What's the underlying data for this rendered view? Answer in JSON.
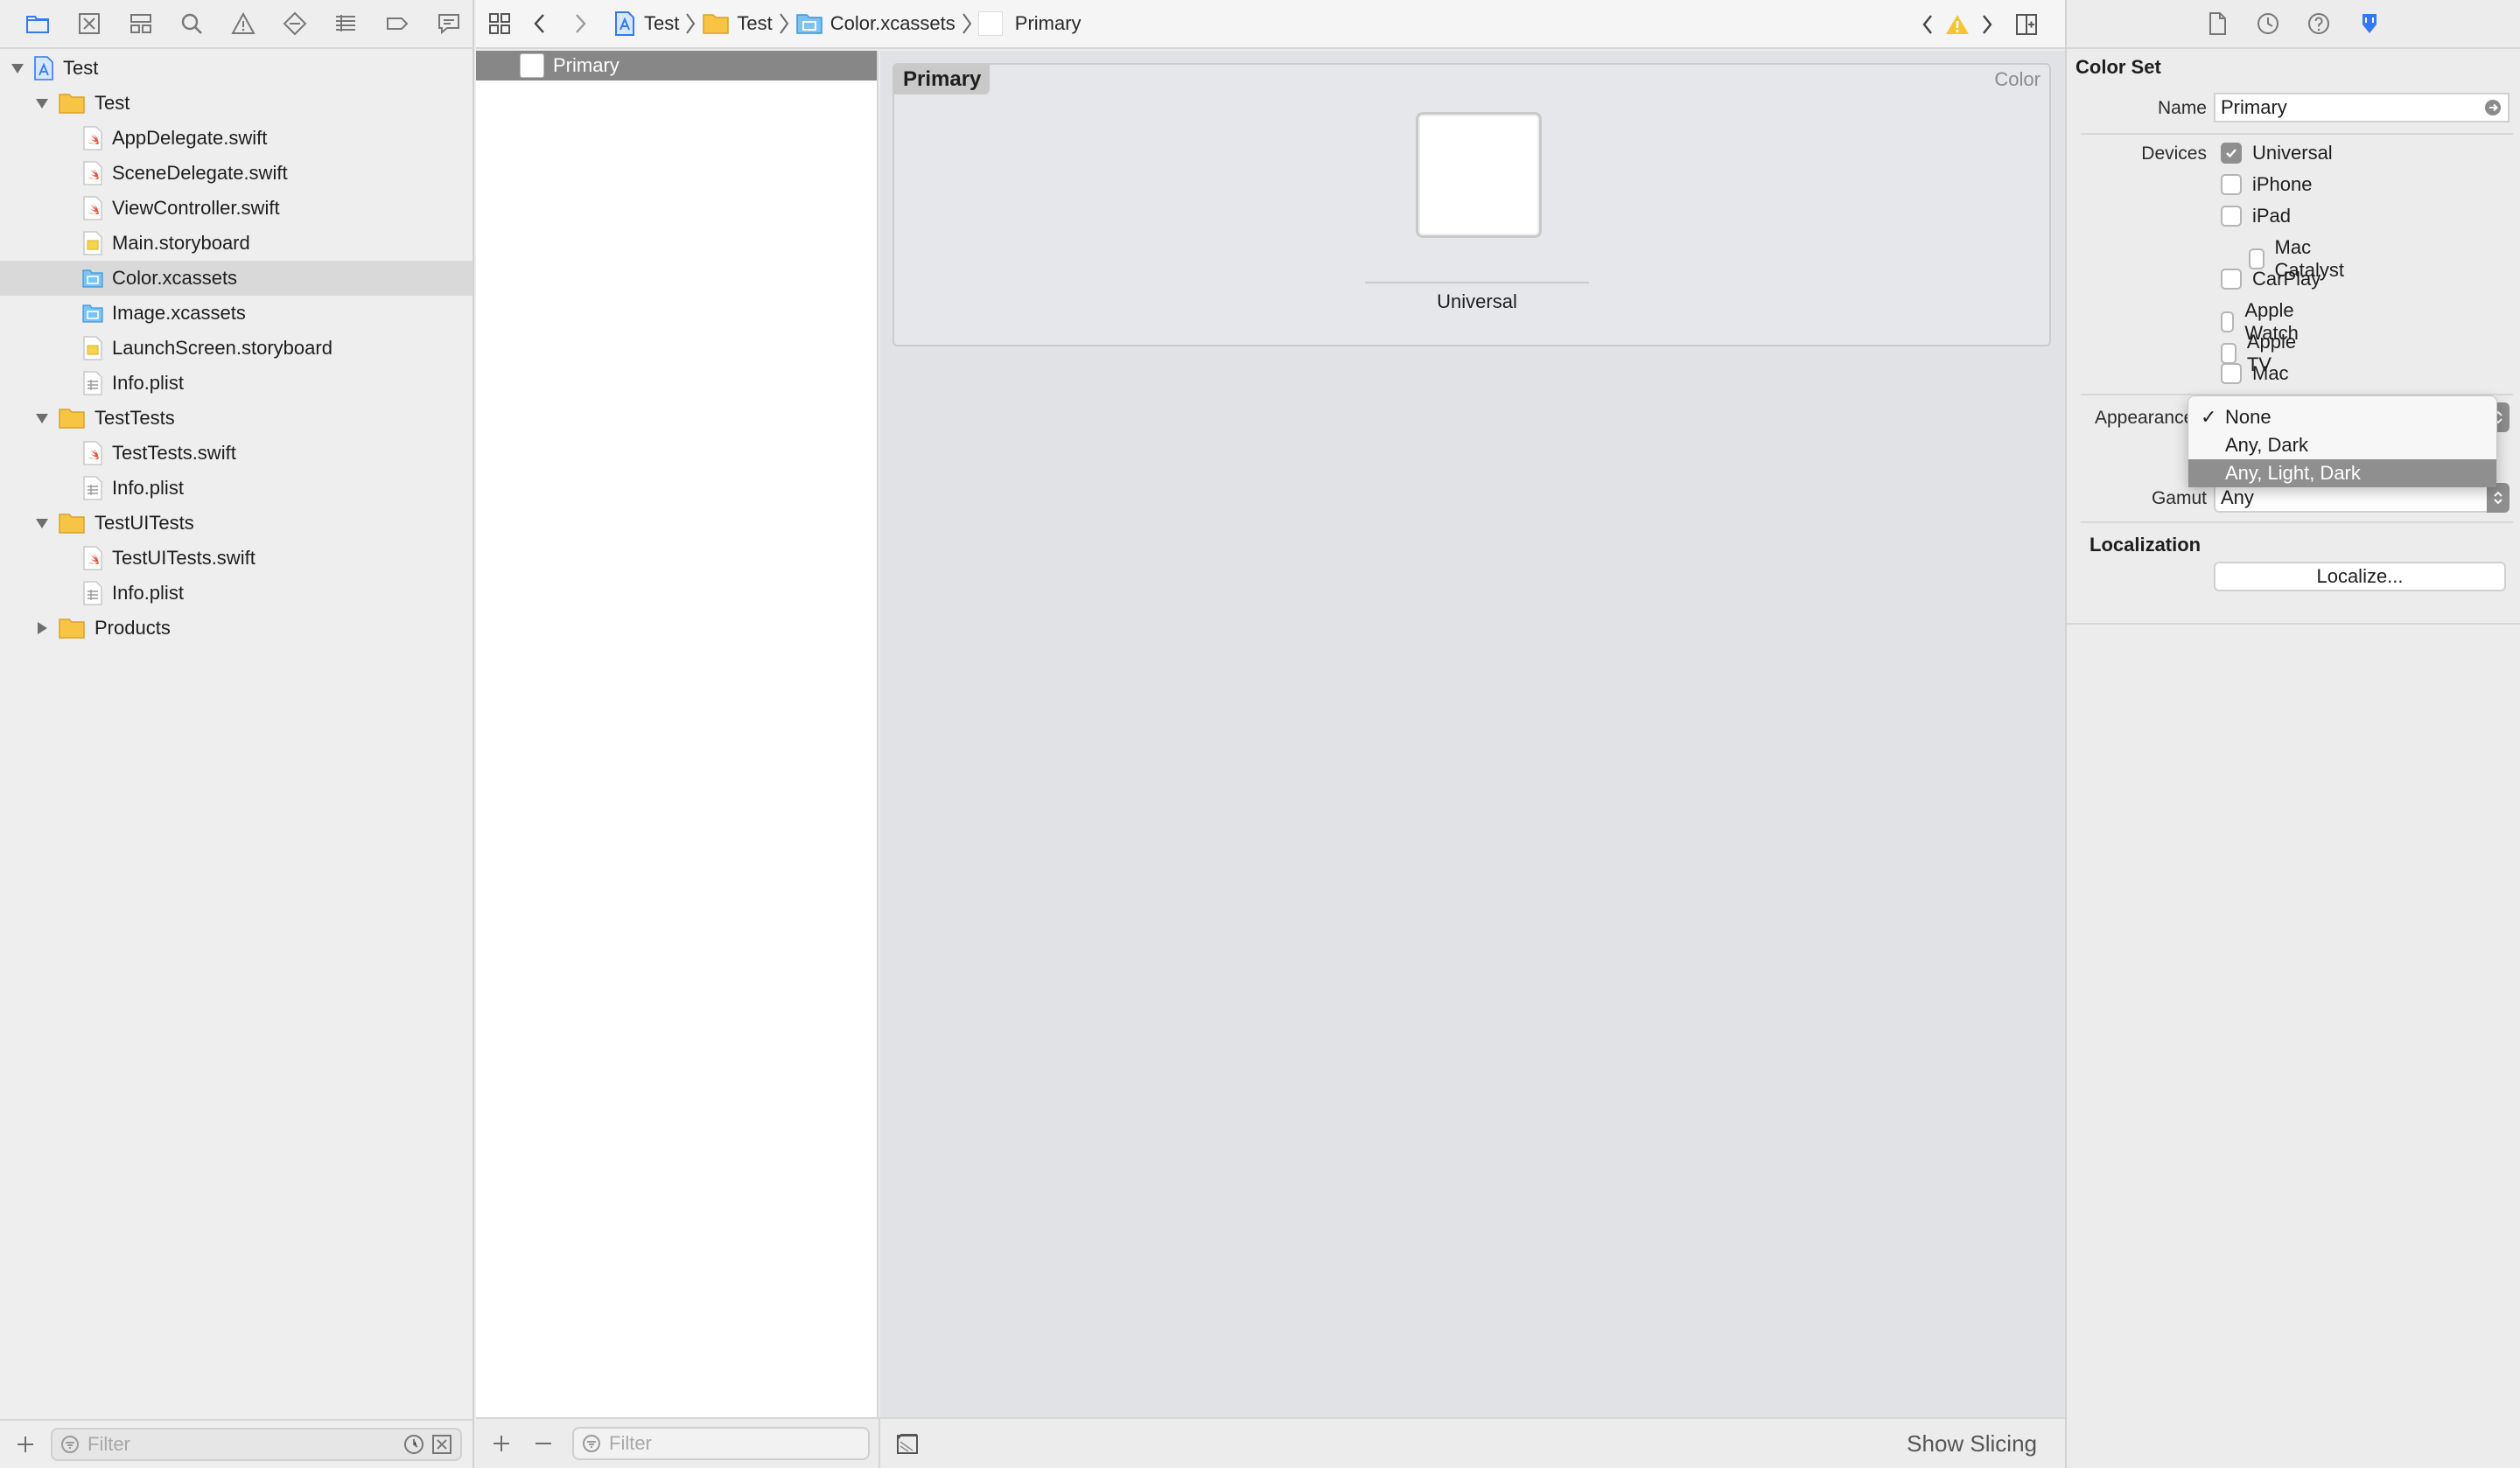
{
  "navigator": {
    "tabs": [
      "folder-icon",
      "source-control-icon",
      "symbol-icon",
      "search-icon",
      "warning-icon",
      "test-icon",
      "debug-icon",
      "breakpoint-icon",
      "report-icon"
    ],
    "tree": [
      {
        "label": "Test",
        "type": "project",
        "depth": 0,
        "expanded": true
      },
      {
        "label": "Test",
        "type": "folder",
        "depth": 1,
        "expanded": true
      },
      {
        "label": "AppDelegate.swift",
        "type": "swift",
        "depth": 2
      },
      {
        "label": "SceneDelegate.swift",
        "type": "swift",
        "depth": 2
      },
      {
        "label": "ViewController.swift",
        "type": "swift",
        "depth": 2
      },
      {
        "label": "Main.storyboard",
        "type": "storyboard",
        "depth": 2
      },
      {
        "label": "Color.xcassets",
        "type": "xcassets",
        "depth": 2,
        "selected": true
      },
      {
        "label": "Image.xcassets",
        "type": "xcassets",
        "depth": 2
      },
      {
        "label": "LaunchScreen.storyboard",
        "type": "storyboard",
        "depth": 2
      },
      {
        "label": "Info.plist",
        "type": "plist",
        "depth": 2
      },
      {
        "label": "TestTests",
        "type": "folder",
        "depth": 1,
        "expanded": true
      },
      {
        "label": "TestTests.swift",
        "type": "swift",
        "depth": 2
      },
      {
        "label": "Info.plist",
        "type": "plist",
        "depth": 2
      },
      {
        "label": "TestUITests",
        "type": "folder",
        "depth": 1,
        "expanded": true
      },
      {
        "label": "TestUITests.swift",
        "type": "swift",
        "depth": 2
      },
      {
        "label": "Info.plist",
        "type": "plist",
        "depth": 2
      },
      {
        "label": "Products",
        "type": "folder",
        "depth": 1,
        "expanded": false
      }
    ],
    "filter_placeholder": "Filter"
  },
  "editor": {
    "breadcrumbs": [
      "Test",
      "Test",
      "Color.xcassets",
      "Primary"
    ],
    "asset_list": {
      "items": [
        "Primary"
      ],
      "filter_placeholder": "Filter"
    },
    "colorset": {
      "title": "Primary",
      "kind": "Color",
      "swatch_label": "Universal",
      "swatch_color": "#ffffff"
    },
    "show_slicing": "Show Slicing"
  },
  "inspector": {
    "section_colorset": "Color Set",
    "name_label": "Name",
    "name_value": "Primary",
    "devices_label": "Devices",
    "devices": [
      {
        "label": "Universal",
        "checked": true,
        "indent": false
      },
      {
        "label": "iPhone",
        "checked": false,
        "indent": false
      },
      {
        "label": "iPad",
        "checked": false,
        "indent": false
      },
      {
        "label": "Mac Catalyst",
        "checked": false,
        "indent": true
      },
      {
        "label": "CarPlay",
        "checked": false,
        "indent": false
      },
      {
        "label": "Apple Watch",
        "checked": false,
        "indent": false
      },
      {
        "label": "Apple TV",
        "checked": false,
        "indent": false
      },
      {
        "label": "Mac",
        "checked": false,
        "indent": false
      }
    ],
    "appearances_label": "Appearances",
    "appearance_menu": [
      {
        "label": "None",
        "checked": true,
        "highlighted": false
      },
      {
        "label": "Any, Dark",
        "checked": false,
        "highlighted": false
      },
      {
        "label": "Any, Light, Dark",
        "checked": false,
        "highlighted": true
      }
    ],
    "gamut_label": "Gamut",
    "gamut_value": "Any",
    "section_localization": "Localization",
    "localize_button": "Localize..."
  }
}
